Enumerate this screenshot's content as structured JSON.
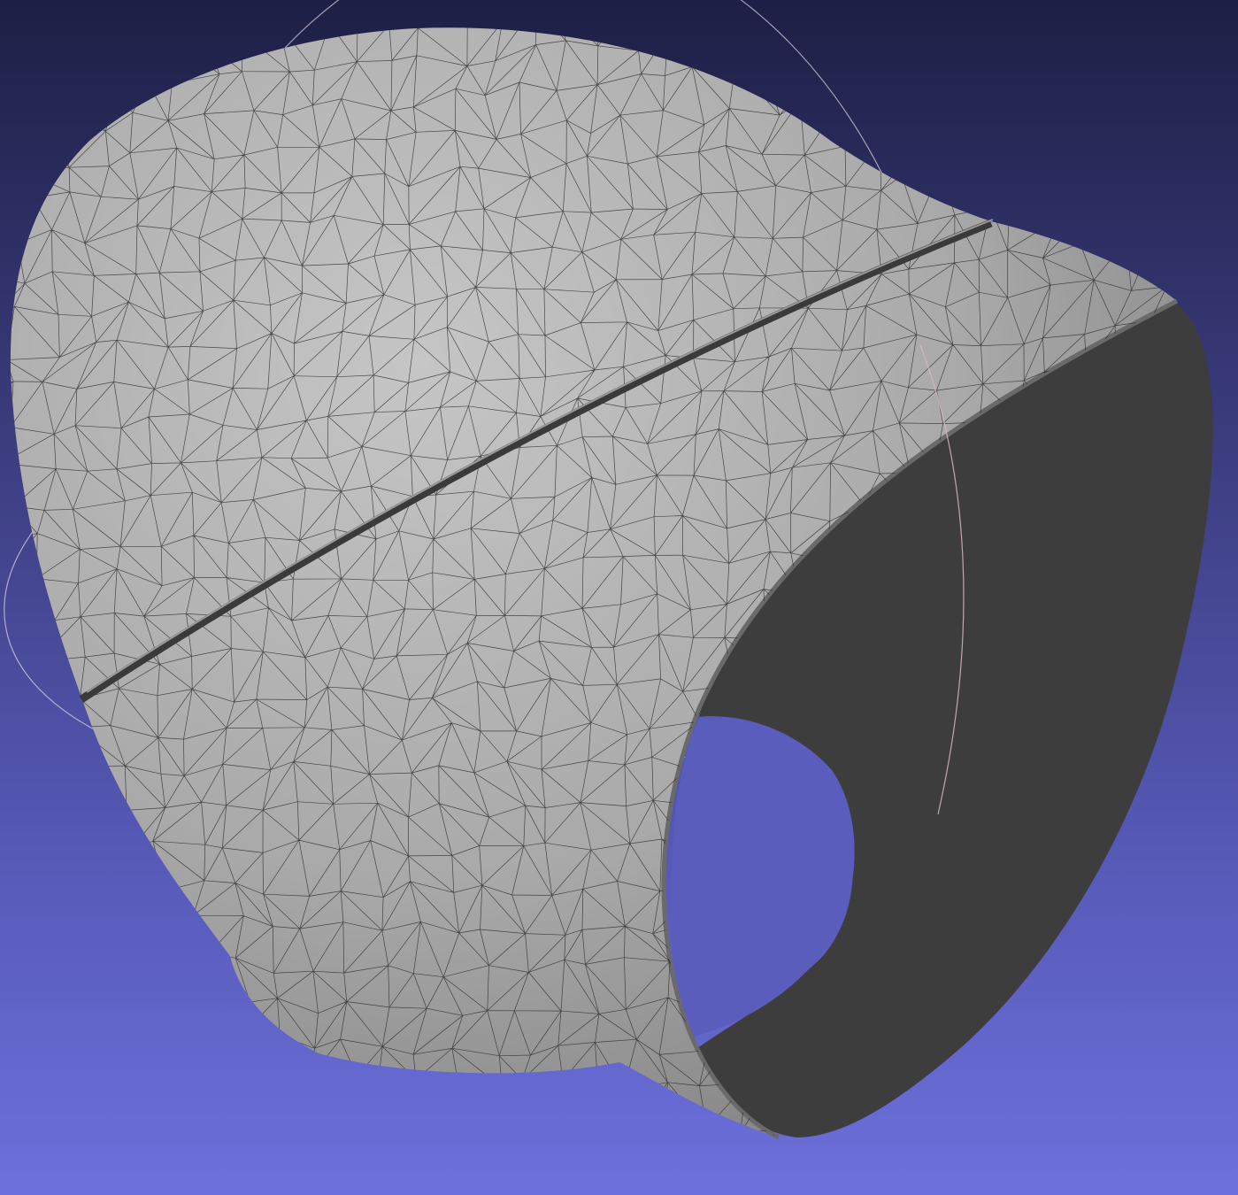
{
  "viewer": {
    "background_top": "#1e1f45",
    "background_bottom": "#6d70dc",
    "mesh_fill": "#aeaeae",
    "mesh_highlight": "#c4c4c4",
    "mesh_shadow": "#7c7c7c",
    "interior_fill": "#3d3d3d",
    "wire_color": "#2a2a2a",
    "trackball_colors": [
      "#d8c8d8",
      "#c8d0d8",
      "#d8d0e0"
    ],
    "render_mode": "flat-lines"
  },
  "model": {
    "shape": "open-shell-wireframe",
    "icon": "mesh-icon"
  }
}
